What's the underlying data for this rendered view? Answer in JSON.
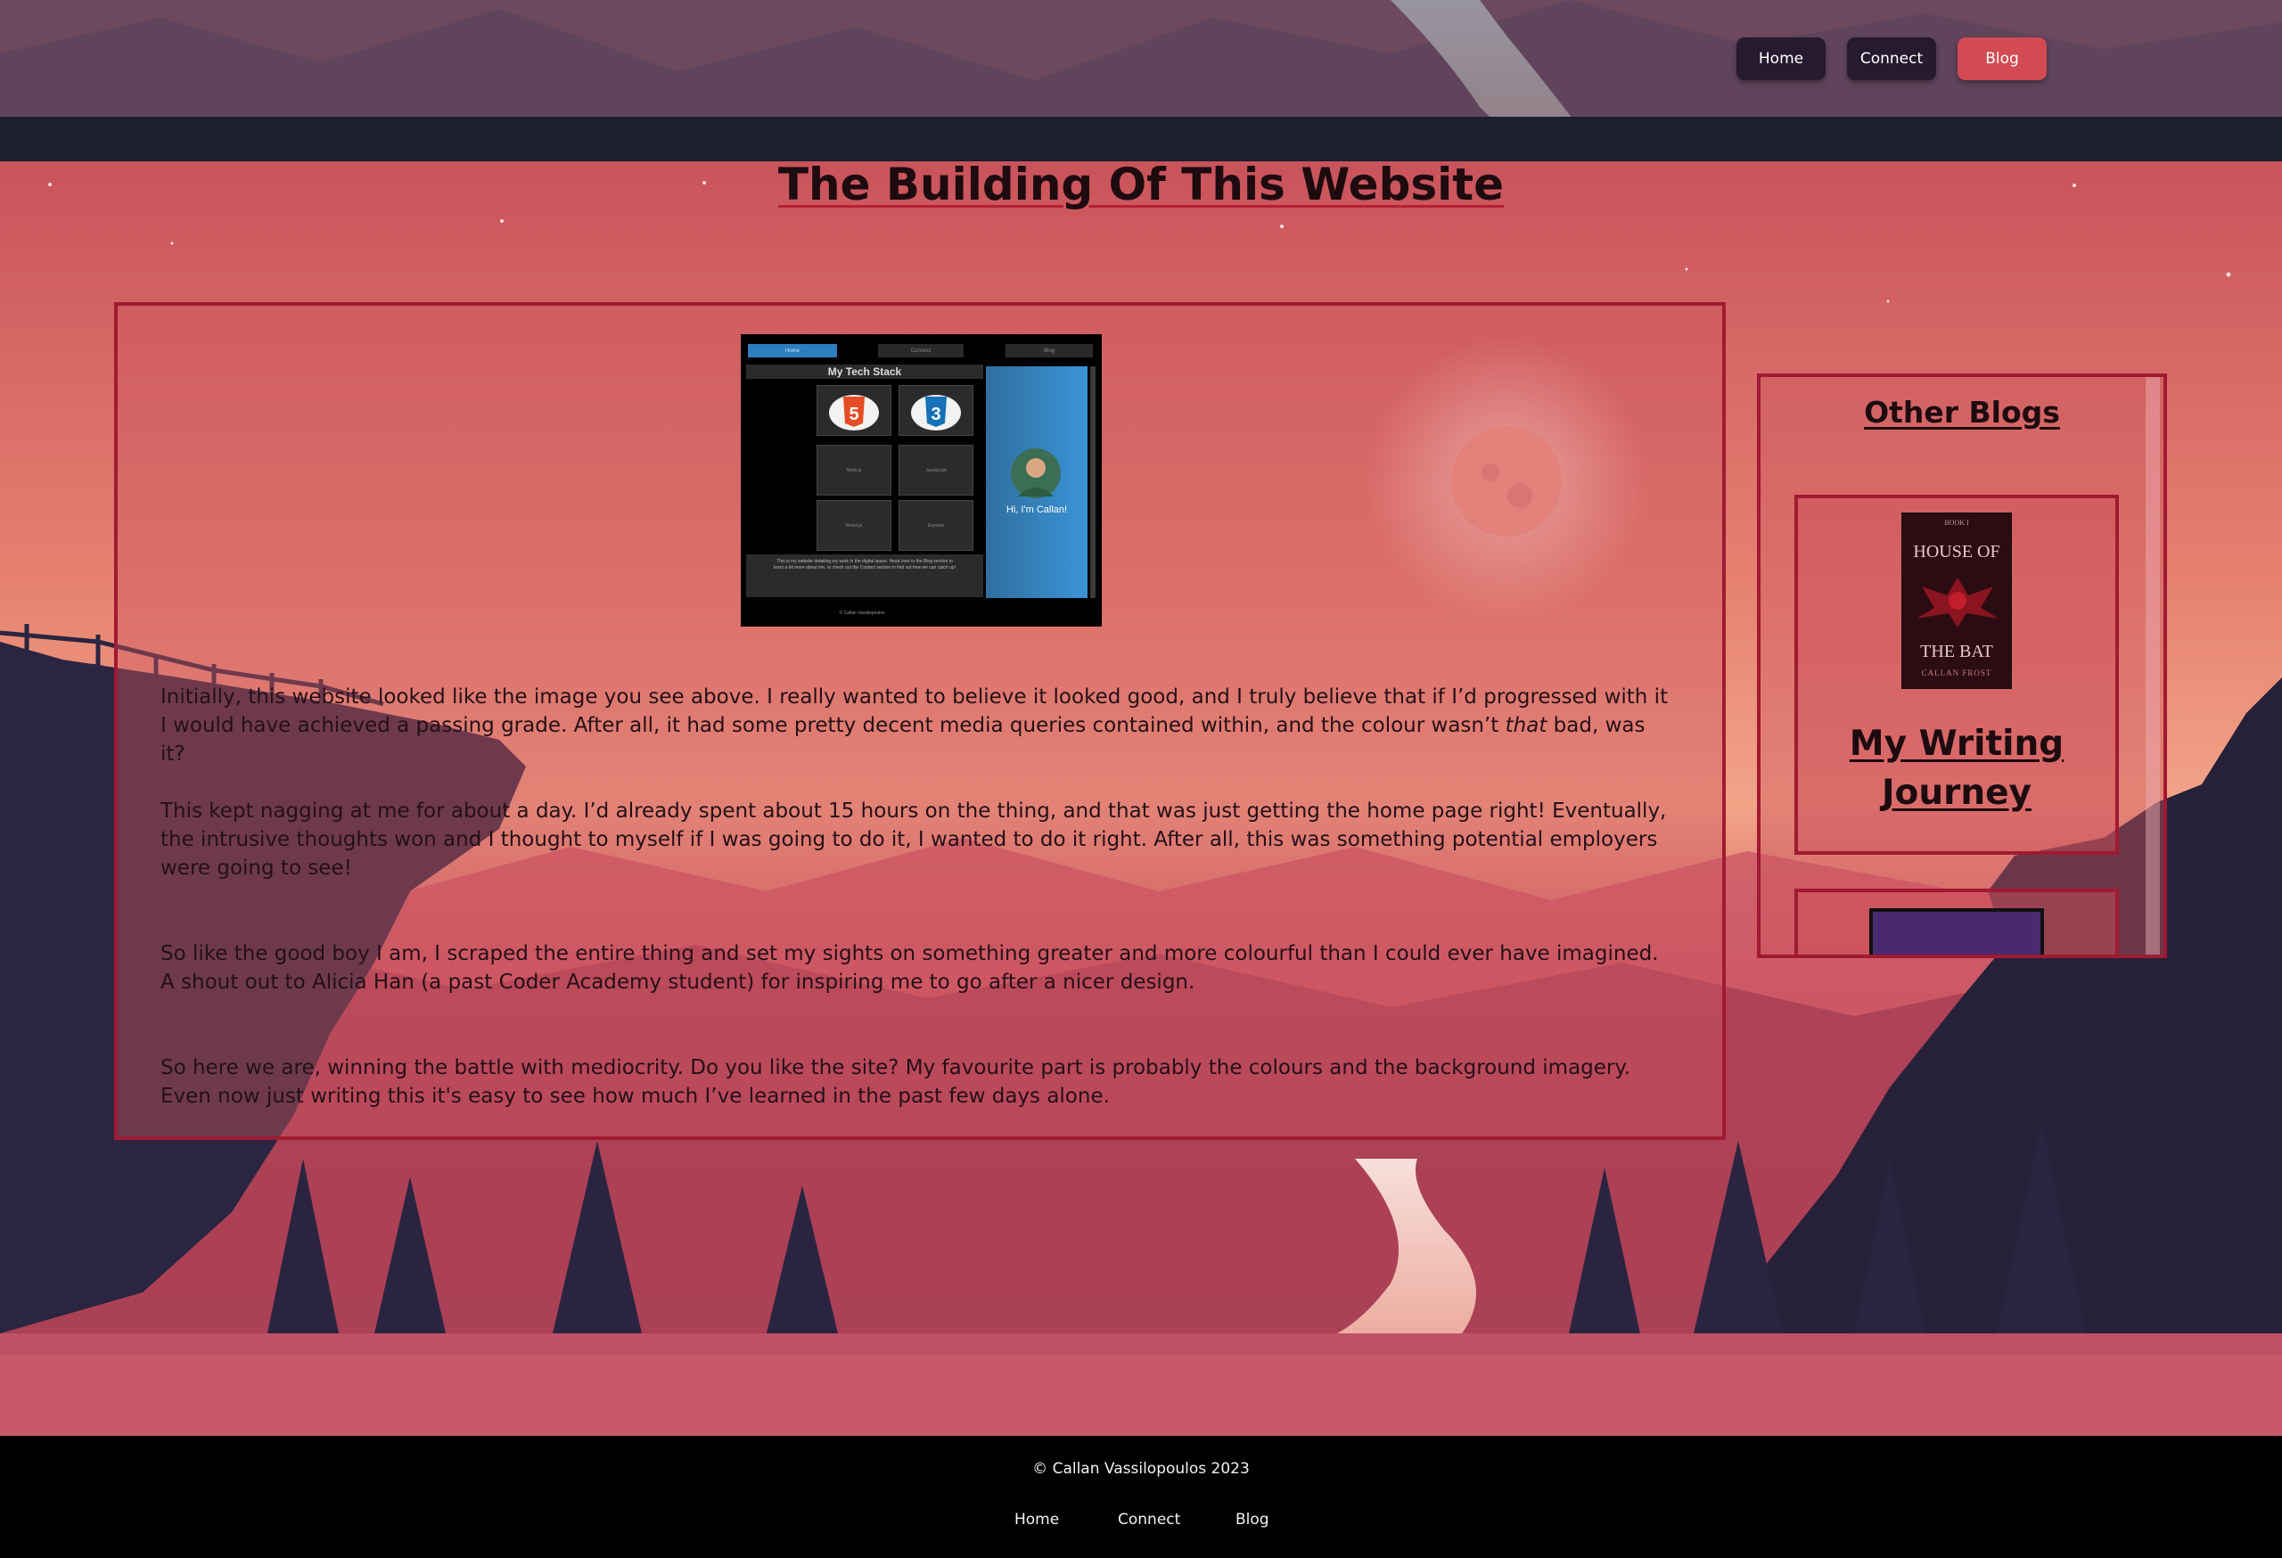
{
  "header": {
    "nav": [
      {
        "label": "Home"
      },
      {
        "label": "Connect"
      },
      {
        "label": "Blog"
      }
    ],
    "active_nav": "Blog"
  },
  "article": {
    "title": "The Building Of This Website",
    "screenshot": {
      "tabs": [
        "Home",
        "Connect",
        "Blog"
      ],
      "heading": "My Tech Stack",
      "tiles": [
        "HTML 5",
        "CSS 3",
        "Node.js",
        "JavaScript",
        "React.js",
        "Express"
      ],
      "profile_text": "Hi, I'm Callan!",
      "intro": "This is my website detailing my work in the digital space. Head over to the Blog section to learn a bit more about me, or check out the Contact section to find out how we can catch up!",
      "footer": "© Callan Vassilopoulos"
    },
    "paragraphs": [
      {
        "before": "Initially, this website looked like the image you see above. I really wanted to believe it looked good, and I truly believe that if I’d progressed with it I would have achieved a passing grade. After all, it had some pretty decent media queries contained within, and the colour wasn’t ",
        "emphasis": "that",
        "after": " bad, was it?"
      },
      {
        "text": "This kept nagging at me for about a day. I’d already spent about 15 hours on the thing, and that was just getting the home page right! Eventually, the intrusive thoughts won and I thought to myself if I was going to do it, I wanted to do it right. After all, this was something potential employers were going to see!"
      },
      {
        "text": "So like the good boy I am, I scraped the entire thing and set my sights on something greater and more colourful than I could ever have imagined. A shout out to Alicia Han (a past Coder Academy student) for inspiring me to go after a nicer design."
      },
      {
        "text": "So here we are, winning the battle with mediocrity. Do you like the site? My favourite part is probably the colours and the background imagery. Even now just writing this it's easy to see how much I’ve learned in the past few days alone."
      }
    ]
  },
  "sidebar": {
    "title": "Other Blogs",
    "cards": [
      {
        "title": "My Writing Journey",
        "cover_top": "HOUSE OF",
        "cover_bottom": "THE BAT",
        "cover_author": "CALLAN FROST",
        "cover_small": "BOOK I"
      },
      {
        "title": ""
      }
    ]
  },
  "footer": {
    "copyright": "© Callan Vassilopoulos 2023",
    "links": [
      {
        "label": "Home"
      },
      {
        "label": "Connect"
      },
      {
        "label": "Blog"
      }
    ]
  },
  "colors": {
    "accent": "#d24b52",
    "border": "#a01a32",
    "nav_dark": "#261a2e",
    "footer": "#000000"
  }
}
